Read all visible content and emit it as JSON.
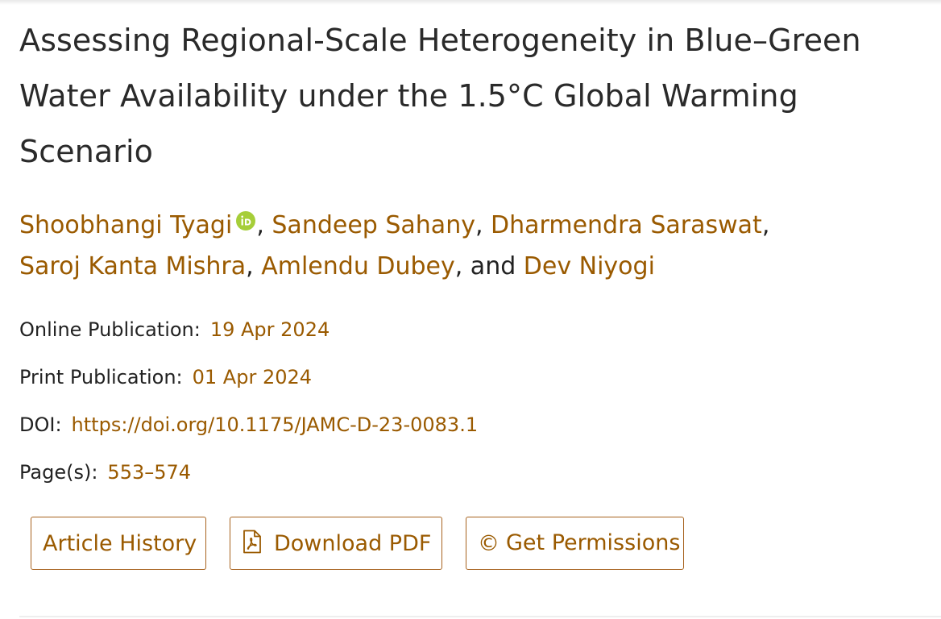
{
  "article": {
    "title": "Assessing Regional-Scale Heterogeneity in Blue–Green Water Availability under the 1.5°C Global Warming Scenario",
    "authors": [
      {
        "name": "Shoobhangi Tyagi",
        "orcid_icon": "orcid-icon",
        "sep": ", "
      },
      {
        "name": "Sandeep Sahany",
        "sep": ", "
      },
      {
        "name": "Dharmendra Saraswat",
        "sep": ","
      },
      {
        "name": "Saroj Kanta Mishra",
        "sep": ", "
      },
      {
        "name": "Amlendu Dubey",
        "sep": ", and "
      },
      {
        "name": "Dev Niyogi",
        "sep": ""
      }
    ],
    "online_publication": {
      "label": "Online Publication:",
      "value": "19 Apr 2024"
    },
    "print_publication": {
      "label": "Print Publication:",
      "value": "01 Apr 2024"
    },
    "doi": {
      "label": "DOI:",
      "value": "https://doi.org/10.1175/JAMC-D-23-0083.1"
    },
    "pages": {
      "label": "Page(s):",
      "value": "553–574"
    }
  },
  "actions": {
    "article_history": "Article History",
    "download_pdf": "Download PDF",
    "download_pdf_icon": "pdf-file-icon",
    "get_permissions": "Get Permissions",
    "get_permissions_icon": "copyright-icon",
    "get_permissions_icon_glyph": "©"
  },
  "colors": {
    "link": "#9a5a00",
    "button_border": "#a7621e",
    "orcid": "#a6ce39",
    "text": "#222222"
  }
}
